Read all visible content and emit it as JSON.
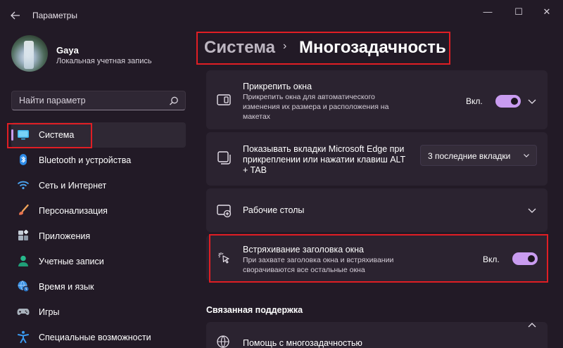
{
  "window": {
    "title": "Параметры",
    "minimize_glyph": "—",
    "maximize_glyph": "☐",
    "close_glyph": "✕"
  },
  "profile": {
    "name": "Gaya",
    "account_type": "Локальная учетная запись"
  },
  "search": {
    "placeholder": "Найти параметр",
    "icon": "search-icon"
  },
  "nav": {
    "items": [
      {
        "label": "Система",
        "icon": "monitor-icon",
        "active": true
      },
      {
        "label": "Bluetooth и устройства",
        "icon": "bluetooth-icon"
      },
      {
        "label": "Сеть и Интернет",
        "icon": "wifi-icon"
      },
      {
        "label": "Персонализация",
        "icon": "brush-icon"
      },
      {
        "label": "Приложения",
        "icon": "apps-icon"
      },
      {
        "label": "Учетные записи",
        "icon": "person-icon"
      },
      {
        "label": "Время и язык",
        "icon": "globe-clock-icon"
      },
      {
        "label": "Игры",
        "icon": "gamepad-icon"
      },
      {
        "label": "Специальные возможности",
        "icon": "accessibility-icon"
      }
    ]
  },
  "breadcrumb": {
    "parent": "Система",
    "separator": "›",
    "current": "Многозадачность"
  },
  "settings": {
    "snap": {
      "title": "Прикрепить окна",
      "description": "Прикрепить окна для автоматического изменения их размера и расположения на макетах",
      "toggle_label": "Вкл.",
      "enabled": true
    },
    "edge_tabs": {
      "title": "Показывать вкладки Microsoft Edge при прикреплении или нажатии клавиш ALT + TAB",
      "selected": "3 последние вкладки"
    },
    "desktops": {
      "title": "Рабочие столы"
    },
    "shake": {
      "title": "Встряхивание заголовка окна",
      "description": "При захвате заголовка окна и встряхивании сворачиваются все остальные окна",
      "toggle_label": "Вкл.",
      "enabled": true
    }
  },
  "related": {
    "heading": "Связанная поддержка",
    "help_item": "Помощь с многозадачностью"
  },
  "colors": {
    "background": "#221a26",
    "card": "#2b2330",
    "accent": "#c99cf0",
    "highlight": "#e01e24"
  }
}
